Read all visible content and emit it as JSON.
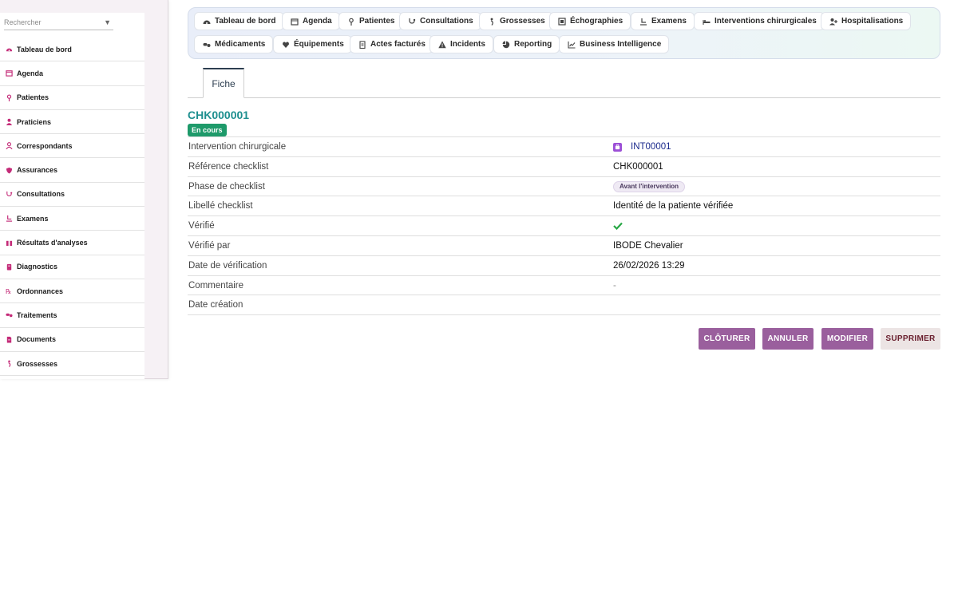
{
  "sidebar": {
    "search_placeholder": "Rechercher",
    "items": [
      {
        "label": "Tableau de bord",
        "icon": "dashboard-icon"
      },
      {
        "label": "Agenda",
        "icon": "calendar-icon"
      },
      {
        "label": "Patientes",
        "icon": "female-icon"
      },
      {
        "label": "Praticiens",
        "icon": "doctor-icon"
      },
      {
        "label": "Correspondants",
        "icon": "user-icon"
      },
      {
        "label": "Assurances",
        "icon": "shield-icon"
      },
      {
        "label": "Consultations",
        "icon": "stethoscope-icon"
      },
      {
        "label": "Examens",
        "icon": "exam-icon"
      },
      {
        "label": "Résultats d'analyses",
        "icon": "lab-icon"
      },
      {
        "label": "Diagnostics",
        "icon": "diagnostic-icon"
      },
      {
        "label": "Ordonnances",
        "icon": "prescription-icon"
      },
      {
        "label": "Traitements",
        "icon": "pills-icon"
      },
      {
        "label": "Documents",
        "icon": "document-icon"
      },
      {
        "label": "Grossesses",
        "icon": "pregnancy-icon"
      }
    ]
  },
  "topnav": {
    "items": [
      {
        "label": "Tableau de bord",
        "icon": "dashboard-icon"
      },
      {
        "label": "Agenda",
        "icon": "calendar-icon"
      },
      {
        "label": "Patientes",
        "icon": "female-icon"
      },
      {
        "label": "Consultations",
        "icon": "stethoscope-icon"
      },
      {
        "label": "Grossesses",
        "icon": "pregnancy-icon"
      },
      {
        "label": "Échographies",
        "icon": "ultrasound-icon"
      },
      {
        "label": "Examens",
        "icon": "exam-icon"
      },
      {
        "label": "Interventions chirurgicales",
        "icon": "surgery-bed-icon"
      },
      {
        "label": "Hospitalisations",
        "icon": "hospital-icon"
      },
      {
        "label": "Médicaments",
        "icon": "pills-icon"
      },
      {
        "label": "Équipements",
        "icon": "equipment-icon"
      },
      {
        "label": "Actes facturés",
        "icon": "invoice-icon"
      },
      {
        "label": "Incidents",
        "icon": "warning-icon"
      },
      {
        "label": "Reporting",
        "icon": "pie-chart-icon"
      },
      {
        "label": "Business Intelligence",
        "icon": "line-chart-icon"
      }
    ]
  },
  "tabs": [
    {
      "label": "Fiche"
    }
  ],
  "record": {
    "title": "CHK000001",
    "status": "En cours",
    "fields": {
      "intervention_label": "Intervention chirurgicale",
      "intervention_value": "INT00001",
      "reference_label": "Référence checklist",
      "reference_value": "CHK000001",
      "phase_label": "Phase de checklist",
      "phase_value": "Avant l'intervention",
      "libelle_label": "Libellé checklist",
      "libelle_value": "Identité de la patiente vérifiée",
      "verifie_label": "Vérifié",
      "verifie_value": "✔",
      "verifie_par_label": "Vérifié par",
      "verifie_par_value": "IBODE Chevalier",
      "date_verif_label": "Date de vérification",
      "date_verif_value": "26/02/2026 13:29",
      "commentaire_label": "Commentaire",
      "commentaire_value": "-",
      "date_creation_label": "Date création",
      "date_creation_value": ""
    }
  },
  "actions": {
    "cloturer": "CLÔTURER",
    "annuler": "ANNULER",
    "modifier": "MODIFIER",
    "supprimer": "SUPPRIMER"
  },
  "colors": {
    "accent_teal": "#1e8f8f",
    "status_green": "#1e9a6a",
    "action_purple": "#9a5f9d",
    "sidebar_icon": "#c42b78"
  }
}
